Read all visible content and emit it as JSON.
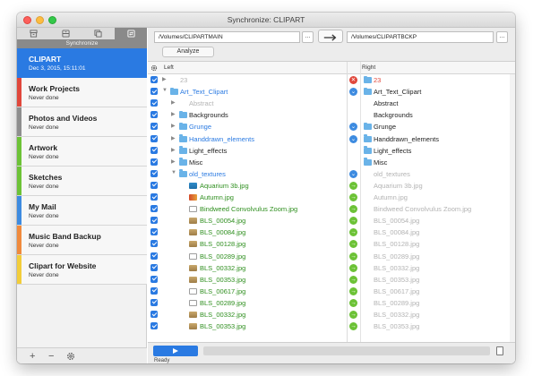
{
  "window": {
    "title": "Synchronize: CLIPART"
  },
  "sidebar": {
    "tabs": [
      {
        "icon": "archive-icon"
      },
      {
        "icon": "box-icon"
      },
      {
        "icon": "copy-icon"
      },
      {
        "icon": "sync-icon",
        "active": true
      }
    ],
    "subtitle": "Synchronize",
    "profiles": [
      {
        "name": "CLIPART",
        "status": "Dec 3, 2015, 15:11:01",
        "color": "#2a7ae2",
        "selected": true
      },
      {
        "name": "Work Projects",
        "status": "Never done",
        "color": "#e0473b"
      },
      {
        "name": "Photos and Videos",
        "status": "Never done",
        "color": "#8e8e8e"
      },
      {
        "name": "Artwork",
        "status": "Never done",
        "color": "#6cc236"
      },
      {
        "name": "Sketches",
        "status": "Never done",
        "color": "#6cc236"
      },
      {
        "name": "My Mail",
        "status": "Never done",
        "color": "#3d8be0"
      },
      {
        "name": "Music Band Backup",
        "status": "Never done",
        "color": "#f08a3c"
      },
      {
        "name": "Clipart for Website",
        "status": "Never done",
        "color": "#f2cd3a"
      }
    ],
    "footer": {
      "add": "+",
      "remove": "−"
    }
  },
  "toolbar": {
    "left_path": "/Volumes/CLIPARTMAIN",
    "right_path": "/Volumes/CLIPARTBCKP",
    "browse": "...",
    "analyze": "Analyze"
  },
  "columns": {
    "left": "Left",
    "right": "Right"
  },
  "rows": [
    {
      "left": "23",
      "right": "23",
      "lclass": "c-gray",
      "rclass": "c-red",
      "act": "red",
      "indent": 0,
      "disc": "▶",
      "licon": "folder-root",
      "ricon": "folder"
    },
    {
      "left": "Art_Text_Clipart",
      "right": "Art_Text_Clipart",
      "lclass": "c-blue",
      "rclass": "c-black",
      "act": "blue",
      "indent": 0,
      "disc": "▼",
      "licon": "folder",
      "ricon": "folder"
    },
    {
      "left": "Abstract",
      "right": "Abstract",
      "lclass": "c-gray",
      "rclass": "c-black",
      "act": "",
      "indent": 1,
      "disc": "▶",
      "licon": "none",
      "ricon": "none"
    },
    {
      "left": "Backgrounds",
      "right": "Backgrounds",
      "lclass": "c-black",
      "rclass": "c-black",
      "act": "",
      "indent": 1,
      "disc": "▶",
      "licon": "folder",
      "ricon": "none"
    },
    {
      "left": "Grunge",
      "right": "Grunge",
      "lclass": "c-blue",
      "rclass": "c-black",
      "act": "blue",
      "indent": 1,
      "disc": "▶",
      "licon": "folder",
      "ricon": "folder"
    },
    {
      "left": "Handdrawn_elements",
      "right": "Handdrawn_elements",
      "lclass": "c-blue",
      "rclass": "c-black",
      "act": "blue",
      "indent": 1,
      "disc": "▶",
      "licon": "folder",
      "ricon": "folder"
    },
    {
      "left": "Light_effects",
      "right": "Light_effects",
      "lclass": "c-black",
      "rclass": "c-black",
      "act": "",
      "indent": 1,
      "disc": "▶",
      "licon": "folder",
      "ricon": "folder"
    },
    {
      "left": "Misc",
      "right": "Misc",
      "lclass": "c-black",
      "rclass": "c-black",
      "act": "",
      "indent": 1,
      "disc": "▶",
      "licon": "folder",
      "ricon": "folder"
    },
    {
      "left": "old_textures",
      "right": "old_textures",
      "lclass": "c-blue",
      "rclass": "c-gray",
      "act": "blue",
      "indent": 1,
      "disc": "▼",
      "licon": "folder",
      "ricon": "none"
    },
    {
      "left": "Aquarium 3b.jpg",
      "right": "Aquarium 3b.jpg",
      "lclass": "c-green",
      "rclass": "c-gray",
      "act": "green",
      "indent": 2,
      "disc": "",
      "licon": "img-sea",
      "ricon": "none"
    },
    {
      "left": "Autumn.jpg",
      "right": "Autumn.jpg",
      "lclass": "c-green",
      "rclass": "c-gray",
      "act": "green",
      "indent": 2,
      "disc": "",
      "licon": "img-aut",
      "ricon": "none"
    },
    {
      "left": "Bindweed Convolvulus Zoom.jpg",
      "right": "Bindweed Convolvulus Zoom.jpg",
      "lclass": "c-green",
      "rclass": "c-gray",
      "act": "green",
      "indent": 2,
      "disc": "",
      "licon": "img-doc",
      "ricon": "none"
    },
    {
      "left": "BLS_00054.jpg",
      "right": "BLS_00054.jpg",
      "lclass": "c-green",
      "rclass": "c-gray",
      "act": "green",
      "indent": 2,
      "disc": "",
      "licon": "img-bls",
      "ricon": "none"
    },
    {
      "left": "BLS_00084.jpg",
      "right": "BLS_00084.jpg",
      "lclass": "c-green",
      "rclass": "c-gray",
      "act": "green",
      "indent": 2,
      "disc": "",
      "licon": "img-bls",
      "ricon": "none"
    },
    {
      "left": "BLS_00128.jpg",
      "right": "BLS_00128.jpg",
      "lclass": "c-green",
      "rclass": "c-gray",
      "act": "green",
      "indent": 2,
      "disc": "",
      "licon": "img-bls",
      "ricon": "none"
    },
    {
      "left": "BLS_00289.jpg",
      "right": "BLS_00289.jpg",
      "lclass": "c-green",
      "rclass": "c-gray",
      "act": "green",
      "indent": 2,
      "disc": "",
      "licon": "img-doc",
      "ricon": "none"
    },
    {
      "left": "BLS_00332.jpg",
      "right": "BLS_00332.jpg",
      "lclass": "c-green",
      "rclass": "c-gray",
      "act": "green",
      "indent": 2,
      "disc": "",
      "licon": "img-bls",
      "ricon": "none"
    },
    {
      "left": "BLS_00353.jpg",
      "right": "BLS_00353.jpg",
      "lclass": "c-green",
      "rclass": "c-gray",
      "act": "green",
      "indent": 2,
      "disc": "",
      "licon": "img-bls",
      "ricon": "none"
    },
    {
      "left": "BLS_00617.jpg",
      "right": "BLS_00617.jpg",
      "lclass": "c-green",
      "rclass": "c-gray",
      "act": "green",
      "indent": 2,
      "disc": "",
      "licon": "img-doc",
      "ricon": "none"
    },
    {
      "left": "BLS_00289.jpg",
      "right": "BLS_00289.jpg",
      "lclass": "c-green",
      "rclass": "c-gray",
      "act": "green",
      "indent": 2,
      "disc": "",
      "licon": "img-doc",
      "ricon": "none"
    },
    {
      "left": "BLS_00332.jpg",
      "right": "BLS_00332.jpg",
      "lclass": "c-green",
      "rclass": "c-gray",
      "act": "green",
      "indent": 2,
      "disc": "",
      "licon": "img-bls",
      "ricon": "none"
    },
    {
      "left": "BLS_00353.jpg",
      "right": "BLS_00353.jpg",
      "lclass": "c-green",
      "rclass": "c-gray",
      "act": "green",
      "indent": 2,
      "disc": "",
      "licon": "img-bls",
      "ricon": "none"
    }
  ],
  "footer": {
    "status": "Ready"
  }
}
